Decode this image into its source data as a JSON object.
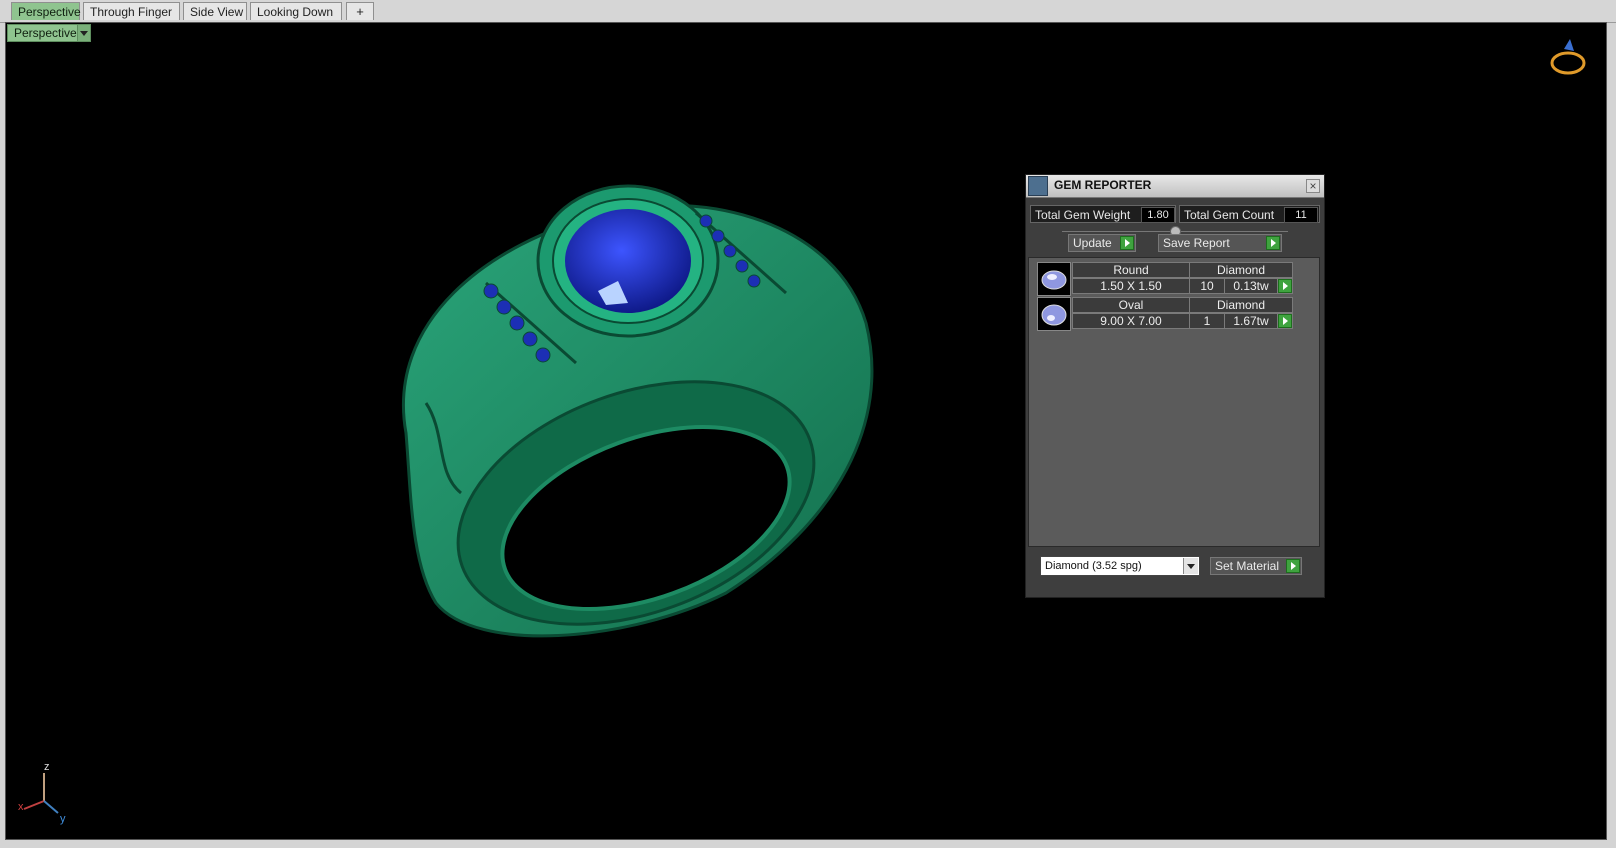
{
  "tabs": [
    {
      "label": "Perspective",
      "active": true
    },
    {
      "label": "Through Finger",
      "active": false
    },
    {
      "label": "Side View",
      "active": false
    },
    {
      "label": "Looking Down",
      "active": false
    }
  ],
  "tab_add_icon": "plus-icon",
  "viewport": {
    "view_dropdown": "Perspective",
    "axes": {
      "z": "z",
      "x": "x",
      "y": "y"
    }
  },
  "gem_reporter": {
    "title": "GEM REPORTER",
    "total_weight_label": "Total Gem Weight",
    "total_weight": "1.80",
    "total_count_label": "Total Gem Count",
    "total_count": "11",
    "update_label": "Update",
    "save_report_label": "Save Report",
    "gems": [
      {
        "shape": "Round",
        "material": "Diamond",
        "size": "1.50 X 1.50",
        "count": "10",
        "weight": "0.13tw"
      },
      {
        "shape": "Oval",
        "material": "Diamond",
        "size": "9.00 X 7.00",
        "count": "1",
        "weight": "1.67tw"
      }
    ],
    "material_select": "Diamond     (3.52 spg)",
    "set_material_label": "Set Material"
  },
  "colors": {
    "ring_green": "#1f8a62",
    "gem_blue": "#1c2fb5",
    "tab_active": "#8fc48f",
    "go_green": "#3fa33f"
  }
}
